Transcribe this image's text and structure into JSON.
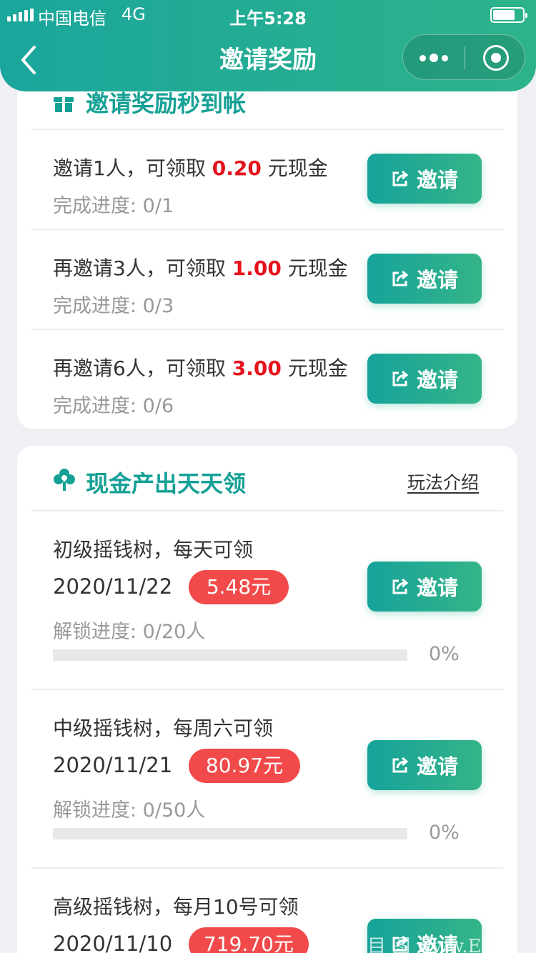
{
  "status_bar": {
    "carrier": "中国电信",
    "network": "4G",
    "time": "上午5:28"
  },
  "header": {
    "title": "邀请奖励"
  },
  "invite_section": {
    "title": "邀请奖励秒到帐",
    "tasks": [
      {
        "prefix": "邀请1人，可领取 ",
        "amount": "0.20",
        "suffix": " 元现金",
        "progress": "完成进度: 0/1",
        "button": "邀请"
      },
      {
        "prefix": "再邀请3人，可领取 ",
        "amount": "1.00",
        "suffix": " 元现金",
        "progress": "完成进度: 0/3",
        "button": "邀请"
      },
      {
        "prefix": "再邀请6人，可领取 ",
        "amount": "3.00",
        "suffix": " 元现金",
        "progress": "完成进度: 0/6",
        "button": "邀请"
      }
    ]
  },
  "cash_section": {
    "title": "现金产出天天领",
    "rules_link": "玩法介绍",
    "trees": [
      {
        "title": "初级摇钱树，每天可领",
        "date": "2020/11/22",
        "amount": "5.48元",
        "unlock": "解锁进度: 0/20人",
        "percent": "0%",
        "progress": 0,
        "button": "邀请"
      },
      {
        "title": "中级摇钱树，每周六可领",
        "date": "2020/11/21",
        "amount": "80.97元",
        "unlock": "解锁进度: 0/50人",
        "percent": "0%",
        "progress": 0,
        "button": "邀请"
      },
      {
        "title": "高级摇钱树，每月10号可领",
        "date": "2020/11/10",
        "amount": "719.70元",
        "button": "邀请"
      }
    ]
  },
  "watermark": "目 图 www.E31",
  "colors": {
    "brand": "#1aa69c",
    "amount_red": "#e5131c",
    "pill_red": "#f24a4a"
  }
}
